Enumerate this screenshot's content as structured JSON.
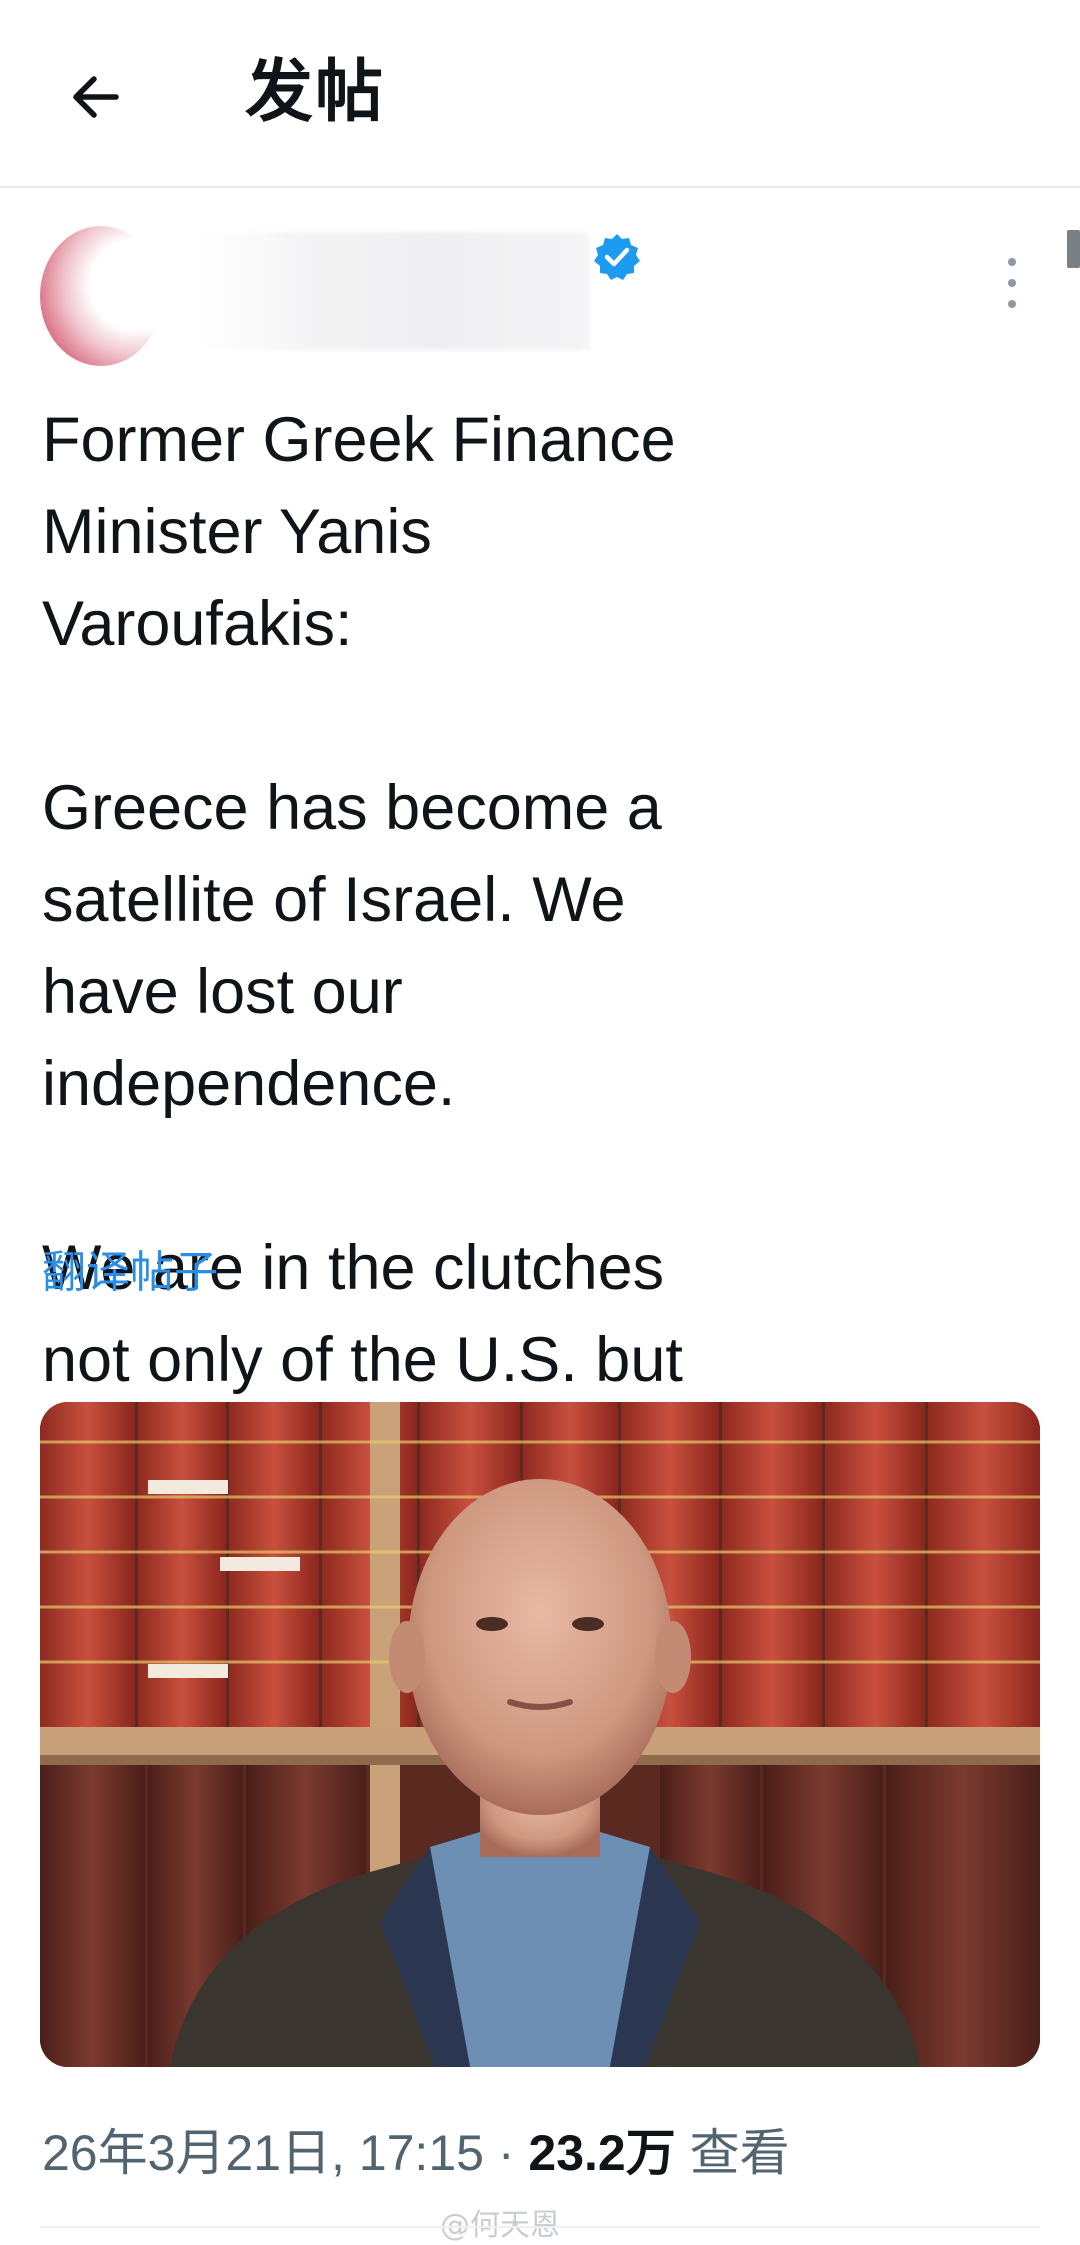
{
  "header": {
    "title": "发帖",
    "back_icon": "arrow-left-icon"
  },
  "author": {
    "avatar_icon": "avatar-image",
    "verified_icon": "verified-badge-icon",
    "menu_icon": "more-vertical-icon"
  },
  "tweet": {
    "paragraphs": [
      "Former Greek Finance Minister Yanis Varoufakis:",
      "Greece has become a satellite of Israel. We have lost our independence.",
      "We are in the clutches not only of the U.S. but also of Israel."
    ],
    "translate_label": "翻译帖子"
  },
  "media": {
    "image_icon": "portrait-photo"
  },
  "meta": {
    "timestamp": "26年3月21日, 17:15",
    "separator": " · ",
    "views_count": "23.2万",
    "views_label": " 查看"
  },
  "watermark": "@何天恩",
  "colors": {
    "link": "#2b8ee6",
    "verified": "#1d9bf0",
    "text": "#0f1419",
    "secondary_text": "#536471"
  }
}
